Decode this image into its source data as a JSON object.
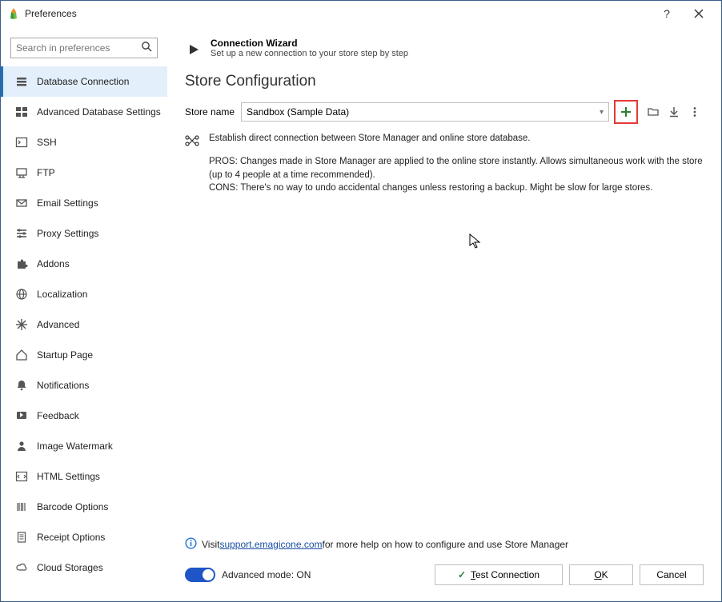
{
  "window": {
    "title": "Preferences"
  },
  "search": {
    "placeholder": "Search in preferences"
  },
  "sidebar": {
    "items": [
      {
        "label": "Database Connection"
      },
      {
        "label": "Advanced Database Settings"
      },
      {
        "label": "SSH"
      },
      {
        "label": "FTP"
      },
      {
        "label": "Email Settings"
      },
      {
        "label": "Proxy Settings"
      },
      {
        "label": "Addons"
      },
      {
        "label": "Localization"
      },
      {
        "label": "Advanced"
      },
      {
        "label": "Startup Page"
      },
      {
        "label": "Notifications"
      },
      {
        "label": "Feedback"
      },
      {
        "label": "Image Watermark"
      },
      {
        "label": "HTML Settings"
      },
      {
        "label": "Barcode Options"
      },
      {
        "label": "Receipt Options"
      },
      {
        "label": "Cloud Storages"
      }
    ]
  },
  "wizard": {
    "title": "Connection Wizard",
    "subtitle": "Set up a new connection to your store step by step"
  },
  "section": {
    "title": "Store Configuration"
  },
  "store": {
    "label": "Store name",
    "value": "Sandbox (Sample Data)"
  },
  "desc": {
    "summary": "Establish direct connection between Store Manager and online store database.",
    "pros": "PROS: Changes made in Store Manager are applied to the online store instantly. Allows simultaneous work with the store (up to 4 people at a time recommended).",
    "cons": "CONS: There's no way to undo accidental changes unless restoring a backup. Might be slow for large stores."
  },
  "help": {
    "prefix": "Visit ",
    "link": "support.emagicone.com",
    "suffix": " for more help on how to configure and use Store Manager"
  },
  "footer": {
    "advanced_label": "Advanced mode: ON",
    "test": "Test Connection",
    "ok": "OK",
    "cancel": "Cancel"
  }
}
